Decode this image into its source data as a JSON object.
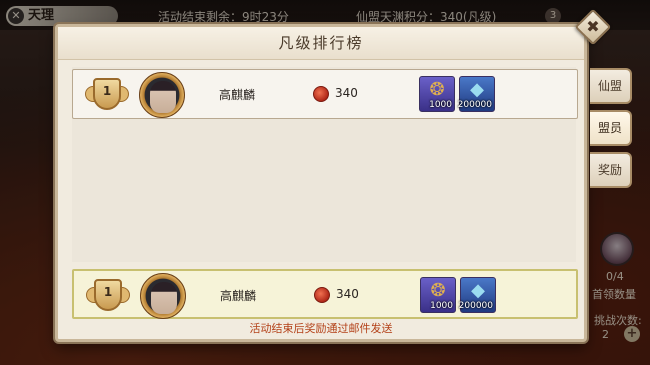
{
  "background": {
    "event_tag": "天理",
    "time_left": "活动结束剩余：9时23分",
    "alliance_points": "仙盟天渊积分：340(凡级)",
    "badge_count": "3",
    "boss_count": "0/4",
    "boss_label": "首领数量",
    "challenge_label": "挑战次数:",
    "challenge_count": "2",
    "add_symbol": "+"
  },
  "panel": {
    "title": "凡级排行榜",
    "footer_note": "活动结束后奖励通过邮件发送"
  },
  "close_symbol": "✖",
  "leaderboard": [
    {
      "rank": "1",
      "name": "高麒麟",
      "power": "340",
      "rewards": [
        {
          "icon": "bronze-emblem-icon",
          "qty": "1000"
        },
        {
          "icon": "blue-crystal-icon",
          "qty": "200000"
        }
      ]
    }
  ],
  "my_row": {
    "rank": "1",
    "name": "高麒麟",
    "power": "340",
    "rewards": [
      {
        "icon": "bronze-emblem-icon",
        "qty": "1000"
      },
      {
        "icon": "blue-crystal-icon",
        "qty": "200000"
      }
    ]
  },
  "tabs": [
    {
      "label": "仙盟"
    },
    {
      "label": "盟员"
    },
    {
      "label": "奖励"
    }
  ],
  "colors": {
    "panel_bg": "#f1ebdf",
    "my_row_bg": "#f6f3d8",
    "footer_text": "#b4421a"
  }
}
